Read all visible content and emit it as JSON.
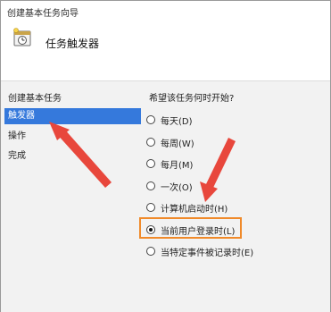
{
  "window": {
    "title": "创建基本任务向导"
  },
  "header": {
    "icon": "task-scheduler-icon",
    "title": "任务触发器"
  },
  "steps": {
    "heading": "创建基本任务",
    "items": [
      {
        "label": "触发器",
        "active": true
      },
      {
        "label": "操作",
        "active": false
      },
      {
        "label": "完成",
        "active": false
      }
    ]
  },
  "trigger": {
    "question": "希望该任务何时开始?",
    "options": [
      {
        "label": "每天(D)",
        "checked": false
      },
      {
        "label": "每周(W)",
        "checked": false
      },
      {
        "label": "每月(M)",
        "checked": false
      },
      {
        "label": "一次(O)",
        "checked": false
      },
      {
        "label": "计算机启动时(H)",
        "checked": false
      },
      {
        "label": "当前用户登录时(L)",
        "checked": true
      },
      {
        "label": "当特定事件被记录时(E)",
        "checked": false
      }
    ]
  },
  "colors": {
    "selection": "#3579dc",
    "annotation": "#e8473c",
    "highlight_border": "#f08a2a"
  }
}
